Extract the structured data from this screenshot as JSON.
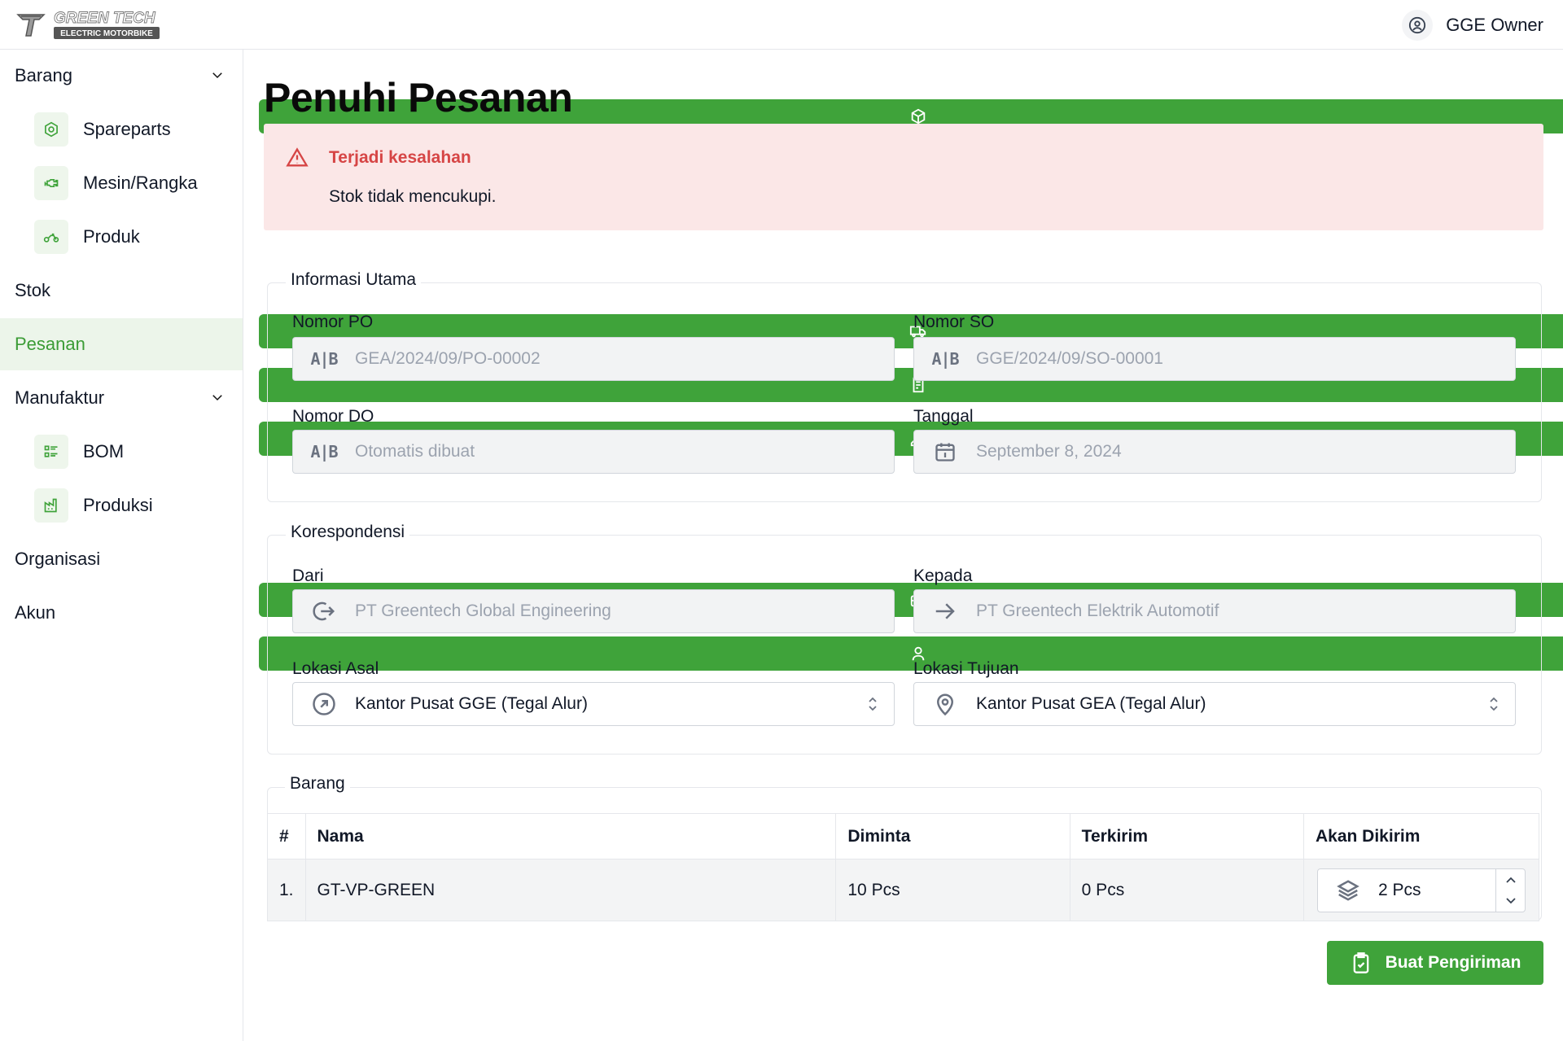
{
  "header": {
    "logo_text_top": "GREEN TECH",
    "logo_text_bottom": "ELECTRIC MOTORBIKE",
    "user_name": "GGE Owner"
  },
  "sidebar": {
    "items": [
      {
        "label": "Barang",
        "icon": "box-icon"
      },
      {
        "label": "Spareparts",
        "icon": "gear-icon"
      },
      {
        "label": "Mesin/Rangka",
        "icon": "engine-icon"
      },
      {
        "label": "Produk",
        "icon": "motorbike-icon"
      },
      {
        "label": "Stok",
        "icon": "truck-icon"
      },
      {
        "label": "Pesanan",
        "icon": "receipt-icon"
      },
      {
        "label": "Manufaktur",
        "icon": "tool-icon"
      },
      {
        "label": "BOM",
        "icon": "list-icon"
      },
      {
        "label": "Produksi",
        "icon": "factory-icon"
      },
      {
        "label": "Organisasi",
        "icon": "briefcase-icon"
      },
      {
        "label": "Akun",
        "icon": "user-icon"
      }
    ]
  },
  "page": {
    "title": "Penuhi Pesanan"
  },
  "alert": {
    "title": "Terjadi kesalahan",
    "message": "Stok tidak mencukupi."
  },
  "info": {
    "legend": "Informasi Utama",
    "po_label": "Nomor PO",
    "po_value": "GEA/2024/09/PO-00002",
    "so_label": "Nomor SO",
    "so_value": "GGE/2024/09/SO-00001",
    "do_label": "Nomor DO",
    "do_placeholder": "Otomatis dibuat",
    "date_label": "Tanggal",
    "date_value": "September 8, 2024"
  },
  "corr": {
    "legend": "Korespondensi",
    "from_label": "Dari",
    "from_value": "PT Greentech Global Engineering",
    "to_label": "Kepada",
    "to_value": "PT Greentech Elektrik Automotif",
    "origin_label": "Lokasi Asal",
    "origin_value": "Kantor Pusat GGE (Tegal Alur)",
    "dest_label": "Lokasi Tujuan",
    "dest_value": "Kantor Pusat GEA (Tegal Alur)"
  },
  "items": {
    "legend": "Barang",
    "headers": [
      "#",
      "Nama",
      "Diminta",
      "Terkirim",
      "Akan Dikirim"
    ],
    "rows": [
      {
        "no": "1.",
        "name": "GT-VP-GREEN",
        "requested": "10 Pcs",
        "sent": "0 Pcs",
        "to_send": "2 Pcs"
      }
    ]
  },
  "actions": {
    "submit_label": "Buat Pengiriman"
  },
  "colors": {
    "accent": "#3fa33a",
    "active_bg": "#ecf5ea",
    "alert_bg": "#fbe7e7",
    "alert_title": "#d64545"
  }
}
